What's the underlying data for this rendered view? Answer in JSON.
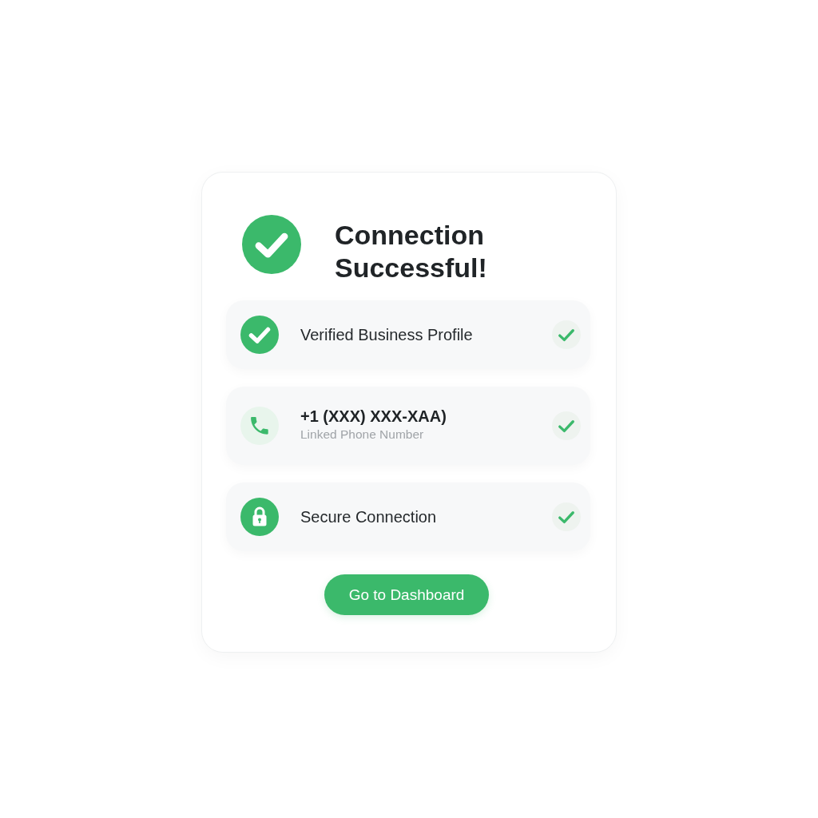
{
  "header": {
    "title": "Connection Successful!"
  },
  "rows": [
    {
      "kind": "check",
      "title": "Verified Business Profile",
      "verified": true
    },
    {
      "kind": "phone",
      "title": "+1 (XXX) XXX-XAA)",
      "subtitle": "Linked Phone Number",
      "verified": true
    },
    {
      "kind": "lock",
      "title": "Secure Connection",
      "verified": true
    }
  ],
  "button": {
    "label": "Go to Dashboard"
  }
}
